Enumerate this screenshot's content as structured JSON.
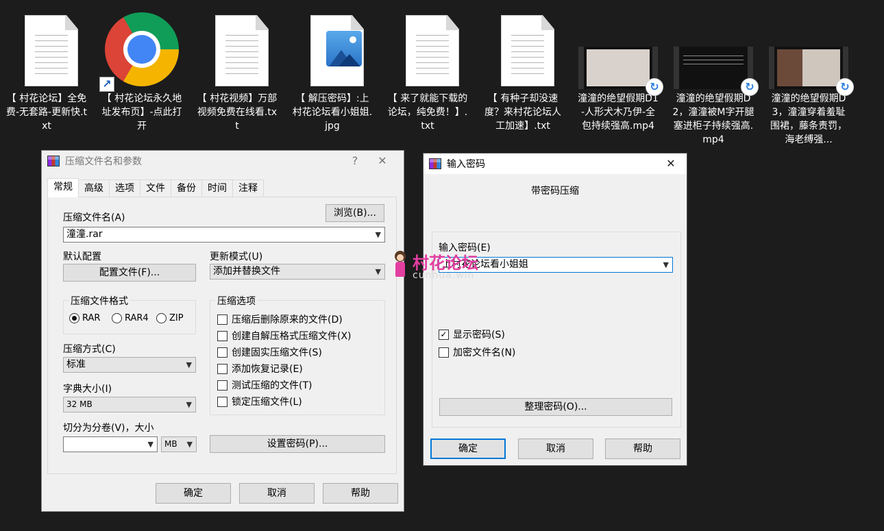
{
  "desktop": {
    "icons": [
      {
        "caption": "【 村花论坛】全免费-无套路-更新快.txt",
        "icon": "text-file-icon"
      },
      {
        "caption": "【 村花论坛永久地址发布页】-点此打开",
        "icon": "chrome-shortcut-icon"
      },
      {
        "caption": "【 村花视频】万部视频免费在线看.txt",
        "icon": "text-file-icon"
      },
      {
        "caption": "【 解压密码】:上村花论坛看小姐姐.jpg",
        "icon": "image-file-icon"
      },
      {
        "caption": "【 来了就能下载的论坛，纯免费！】.txt",
        "icon": "text-file-icon"
      },
      {
        "caption": "【 有种子却没速度？来村花论坛人工加速】.txt",
        "icon": "text-file-icon"
      },
      {
        "caption": "潼潼的绝望假期D1-人形犬木乃伊-全包持续强高.mp4",
        "icon": "video-file-icon"
      },
      {
        "caption": "潼潼的绝望假期D2，潼潼被M字开腿塞进柜子持续强高.mp4",
        "icon": "video-file-icon"
      },
      {
        "caption": "潼潼的绝望假期D3，潼潼穿着羞耻围裙，藤条责罚，海老缚强...",
        "icon": "video-file-icon"
      }
    ]
  },
  "archive_dialog": {
    "title": "压缩文件名和参数",
    "help_btn": "?",
    "close_btn": "✕",
    "tabs": [
      "常规",
      "高级",
      "选项",
      "文件",
      "备份",
      "时间",
      "注释"
    ],
    "archive_name_label": "压缩文件名(A)",
    "browse_btn": "浏览(B)...",
    "archive_name_value": "潼潼.rar",
    "default_profile_label": "默认配置",
    "profiles_btn": "配置文件(F)...",
    "update_mode_label": "更新模式(U)",
    "update_mode_value": "添加并替换文件",
    "format_group": "压缩文件格式",
    "formats": [
      "RAR",
      "RAR4",
      "ZIP"
    ],
    "selected_format": "RAR",
    "method_label": "压缩方式(C)",
    "method_value": "标准",
    "dict_label": "字典大小(I)",
    "dict_value": "32 MB",
    "split_label": "切分为分卷(V)，大小",
    "split_value": "",
    "split_unit": "MB",
    "set_password_btn": "设置密码(P)...",
    "options_group": "压缩选项",
    "options": [
      {
        "label": "压缩后删除原来的文件(D)",
        "checked": false
      },
      {
        "label": "创建自解压格式压缩文件(X)",
        "checked": false
      },
      {
        "label": "创建固实压缩文件(S)",
        "checked": false
      },
      {
        "label": "添加恢复记录(E)",
        "checked": false
      },
      {
        "label": "测试压缩的文件(T)",
        "checked": false
      },
      {
        "label": "锁定压缩文件(L)",
        "checked": false
      }
    ],
    "ok_btn": "确定",
    "cancel_btn": "取消",
    "help_button": "帮助"
  },
  "password_dialog": {
    "title": "输入密码",
    "close_btn": "✕",
    "heading": "带密码压缩",
    "password_label": "输入密码(E)",
    "password_value": "上村花论坛看小姐姐",
    "show_password": {
      "label": "显示密码(S)",
      "checked": true
    },
    "encrypt_names": {
      "label": "加密文件名(N)",
      "checked": false
    },
    "organize_btn": "整理密码(O)...",
    "ok_btn": "确定",
    "cancel_btn": "取消",
    "help_btn": "帮助"
  },
  "watermark": {
    "text": "村花论坛",
    "url": "cunhua.win"
  }
}
